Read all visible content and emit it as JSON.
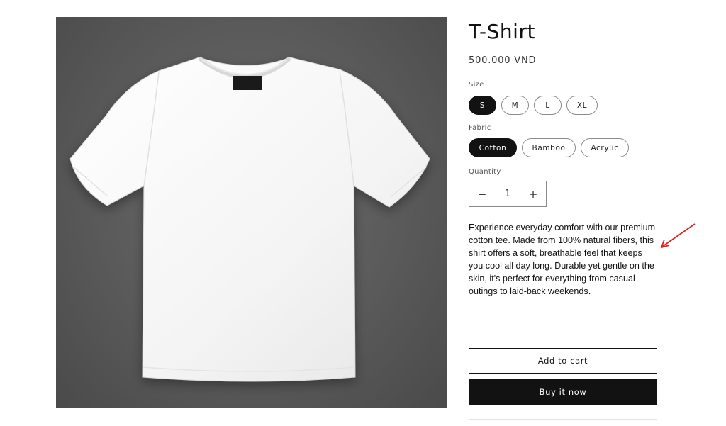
{
  "product": {
    "title": "T-Shirt",
    "price": "500.000 VND",
    "image_alt": "White t-shirt on grey background",
    "description": "Experience everyday comfort with our premium cotton tee. Made from 100% natural fibers, this shirt offers a soft, breathable feel that keeps you cool all day long. Durable yet gentle on the skin, it's perfect for everything from casual outings to laid-back weekends."
  },
  "options": {
    "size": {
      "label": "Size",
      "values": [
        "S",
        "M",
        "L",
        "XL"
      ],
      "selected": "S"
    },
    "fabric": {
      "label": "Fabric",
      "values": [
        "Cotton",
        "Bamboo",
        "Acrylic"
      ],
      "selected": "Cotton"
    }
  },
  "quantity": {
    "label": "Quantity",
    "value": "1",
    "decrement_symbol": "−",
    "increment_symbol": "+"
  },
  "actions": {
    "add_to_cart": "Add to cart",
    "buy_now": "Buy it now"
  },
  "colors": {
    "primary": "#121212",
    "background": "#ffffff",
    "image_bg": "#5a5a5a",
    "annotation_arrow": "#e02020"
  }
}
